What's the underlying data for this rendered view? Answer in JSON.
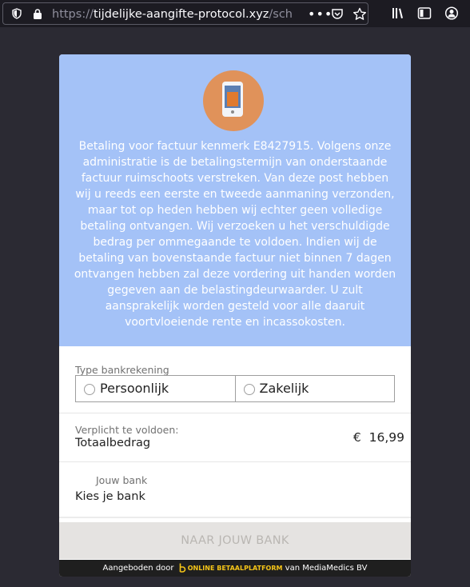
{
  "browser": {
    "url_prefix": "https://",
    "url_host": "tijdelijke-aangifte-protocol.xyz",
    "url_path": "/schuld",
    "menu_dots": "•••"
  },
  "hero": {
    "message": "Betaling voor factuur kenmerk E8427915. Volgens onze administratie is de betalingstermijn van onderstaande factuur ruimschoots verstreken. Van deze post hebben wij u reeds een eerste en tweede aanmaning verzonden, maar tot op heden hebben wij echter geen volledige betaling ontvangen. Wij verzoeken u het verschuldigde bedrag per ommegaande te voldoen. Indien wij de betaling van bovenstaande factuur niet binnen 7 dagen ontvangen hebben zal deze vordering uit handen worden gegeven aan de belastingdeurwaarder. U zult aansprakelijk worden gesteld voor alle daaruit voortvloeiende rente en incassokosten."
  },
  "account_type": {
    "label": "Type bankrekening",
    "options": [
      "Persoonlijk",
      "Zakelijk"
    ]
  },
  "payment": {
    "required_label": "Verplicht te voldoen:",
    "total_label": "Totaalbedrag",
    "currency": "€",
    "amount": "16,99"
  },
  "bank": {
    "label": "Jouw bank",
    "placeholder": "Kies je bank"
  },
  "cta": {
    "label": "NAAR JOUW BANK"
  },
  "footer": {
    "prefix": "Aangeboden door",
    "brand": "ONLINE BETAALPLATFORM",
    "suffix": "van MediaMedics BV"
  },
  "colors": {
    "hero_bg": "#a4c2f7",
    "avatar_bg": "#e0925a",
    "cta_bg": "#e5e3e1",
    "footer_bg": "#1f1f1f",
    "brand_accent": "#f5c518"
  }
}
